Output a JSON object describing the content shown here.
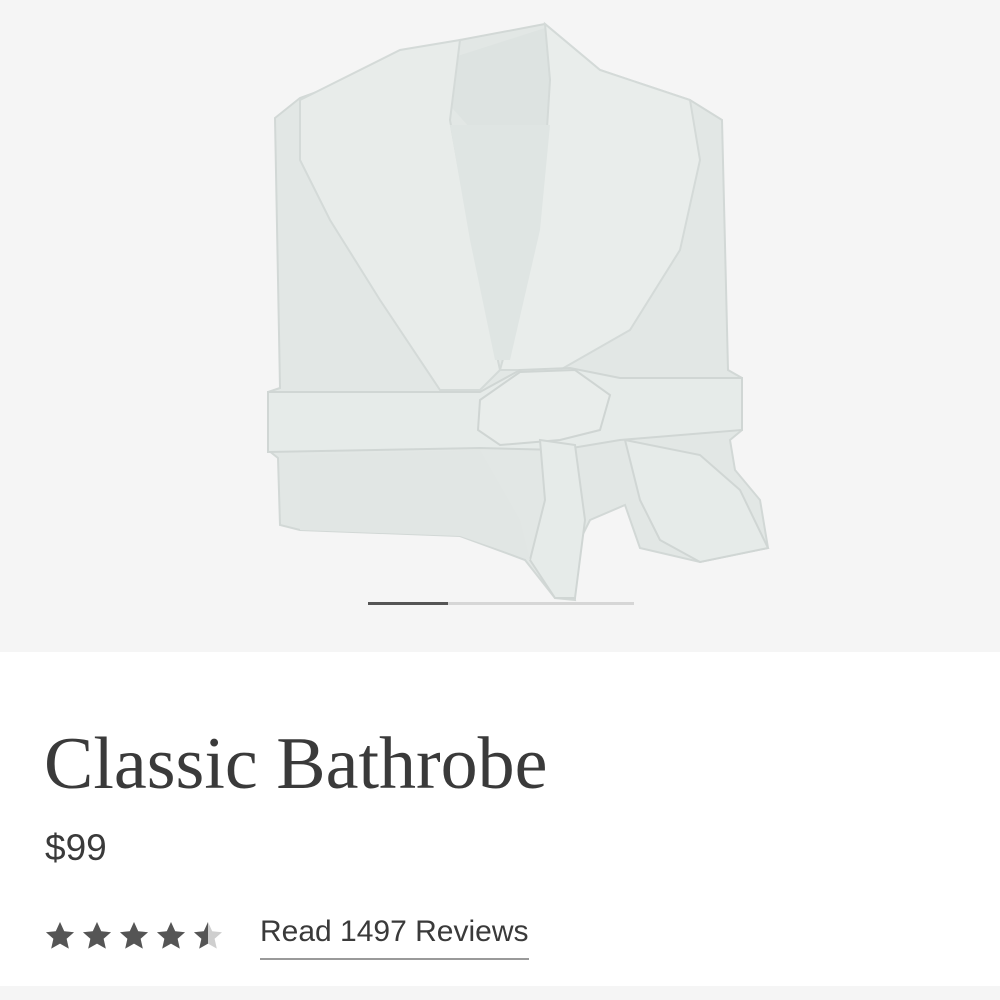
{
  "product": {
    "title": "Classic Bathrobe",
    "price": "$99",
    "rating_value": 4.5,
    "rating_max": 5,
    "reviews_link": "Read 1497 Reviews"
  },
  "gallery": {
    "image_icon": "bathrobe-image",
    "carousel_progress_fraction": 0.3
  },
  "colors": {
    "text": "#3a3a3a",
    "star_filled": "#555555",
    "star_empty": "#cfcfcf",
    "gallery_bg": "#f5f5f5",
    "robe": "#e3e8e6"
  }
}
